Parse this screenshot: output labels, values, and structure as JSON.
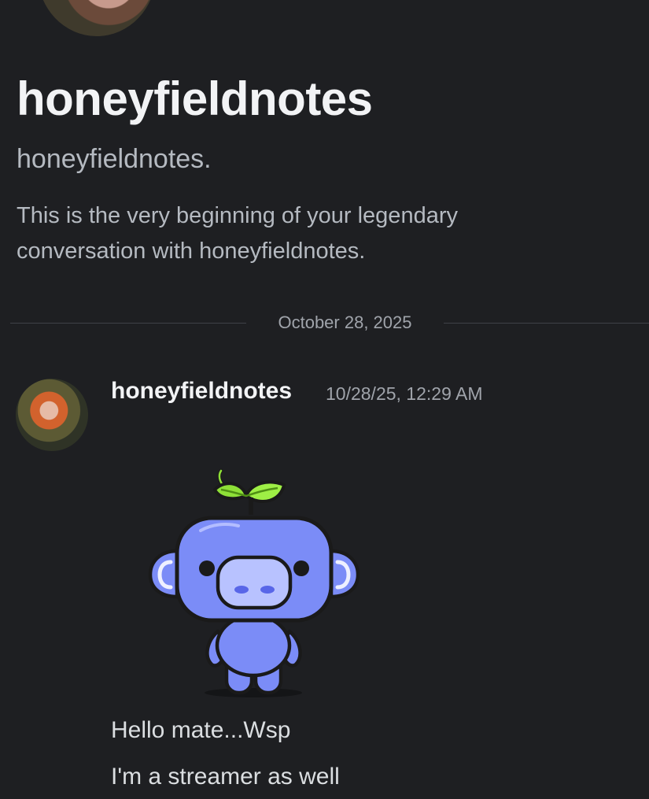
{
  "profile": {
    "display_name": "honeyfieldnotes",
    "username": "honeyfieldnotes.",
    "intro": "This is the very beginning of your legendary conversation with honeyfieldnotes."
  },
  "divider": {
    "date": "October 28, 2025"
  },
  "message": {
    "author": "honeyfieldnotes",
    "timestamp": "10/28/25, 12:29 AM",
    "sticker_icon": "wumpus-sprout-sticker",
    "lines": [
      "Hello mate...Wsp",
      "I'm a streamer as well"
    ]
  },
  "colors": {
    "background": "#1e1f22",
    "text_primary": "#f2f3f5",
    "text_muted": "#b5bac1",
    "wumpus_body": "#7b8cf7",
    "leaf": "#8ee037"
  }
}
